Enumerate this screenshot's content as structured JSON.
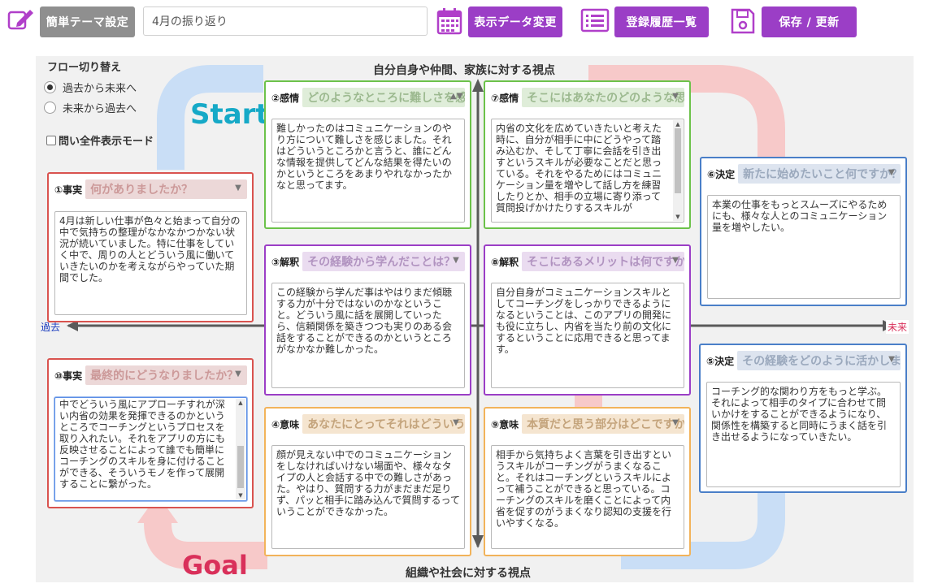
{
  "toolbar": {
    "theme_button": "簡単テーマ設定",
    "title_value": "4月の振り返り",
    "display_data_button": "表示データ変更",
    "history_button": "登録履歴一覧",
    "save_button": "保存 / 更新"
  },
  "controls": {
    "flow_title": "フロー切り替え",
    "flow_options": [
      "過去から未来へ",
      "未来から過去へ"
    ],
    "selected_flow": "過去から未来へ",
    "show_all_label": "問い全件表示モード"
  },
  "axis": {
    "top": "自分自身や仲間、家族に対する視点",
    "bottom": "組織や社会に対する視点",
    "left": "過去",
    "right": "未来"
  },
  "flow": {
    "start": "Start",
    "goal": "Goal"
  },
  "cards": {
    "c1": {
      "label": "①事実",
      "question": "何がありましたか？",
      "answer": "4月は新しい仕事が色々と始まって自分の中で気持ちの整理がなかなかつかない状況が続いていました。特に仕事をしていく中で、周りの人とどういう風に働いていきたいのかを考えながらやっていた期間でした。"
    },
    "c2": {
      "label": "②感情",
      "question": "どのようなところに難しさを感じましたか？",
      "answer": "難しかったのはコミュニケーションのやり方について難しさを感じました。それはどういうところかと言うと、誰にどんな情報を提供してどんな結果を得たいのかというところをあまりやれなかったかなと思ってます。"
    },
    "c3": {
      "label": "③解釈",
      "question": "その経験から学んだことは？",
      "answer": "この経験から学んだ事はやはりまだ傾聴する力が十分ではないのかなということ。どういう風に話を展開していったら、信頼関係を築きつつも実りのある会話をすることができるのかというところがなかなか難しかった。"
    },
    "c4": {
      "label": "④意味",
      "question": "あなたにとってそれはどういう意味がありますか？",
      "answer": "顔が見えない中でのコミュニケーションをしなければいけない場面や、様々なタイプの人と会話する中での難しさがあった。やはり、質問する力がまだまだ足りず、パッと相手に踏み込んで質問するっていうことができなかった。"
    },
    "c5": {
      "label": "⑤決定",
      "question": "その経験をどのように活かしますか？",
      "answer": "コーチング的な関わり方をもっと学ぶ。それによって相手のタイプに合わせて問いかけをすることができるようになり、関係性を構築すると同時にうまく話を引き出せるようになっていきたい。"
    },
    "c6": {
      "label": "⑥決定",
      "question": "新たに始めたいこと何ですか？",
      "answer": "本業の仕事をもっとスムーズにやるためにも、様々な人とのコミュニケーション量を増やしたい。"
    },
    "c7": {
      "label": "⑦感情",
      "question": "そこにはあなたのどのような思いがありますか？",
      "answer": "内省の文化を広めていきたいと考えた時に、自分が相手に中にどうやって踏み込むか、そして丁寧に会話を引き出すというスキルが必要なことだと思っている。それをやるためにはコミュニケーション量を増やして話し方を練習したりとか、相手の立場に寄り添って質問投げかけたりするスキルが"
    },
    "c8": {
      "label": "⑧解釈",
      "question": "そこにあるメリットは何ですか？",
      "answer": "自分自身がコミュニケーションスキルとしてコーチングをしっかりできるようになるということは、このアプリの開発にも役に立ちし、内省を当たり前の文化にするということに応用できると思ってます。"
    },
    "c9": {
      "label": "⑨意味",
      "question": "本質だと思う部分はどこですか？",
      "answer": "相手から気持ちよく言葉を引き出すというスキルがコーチングがうまくなること。それはコーチングというスキルによって補うことができると思っている。コーチングのスキルを磨くことによって内省を促すのがうまくなり認知の支援を行いやすくなる。"
    },
    "c10": {
      "label": "⑩事実",
      "question": "最終的にどうなりましたか？",
      "answer": "中でどういう風にアプローチすれが深い内省の効果を発揮できるのかというところでコーチングというプロセスを取り入れたい。それをアプリの方にも反映させることによって誰でも簡単にコーチングのスキルを身に付けることができる、そういうモノを作って展開することに繋がった。"
    }
  },
  "colors": {
    "accent_purple": "#9b3ec6",
    "start_text": "#16a9c7",
    "goal_text": "#d9305a",
    "flow_blue": "#c9def6",
    "flow_red": "#f7c9c9"
  }
}
